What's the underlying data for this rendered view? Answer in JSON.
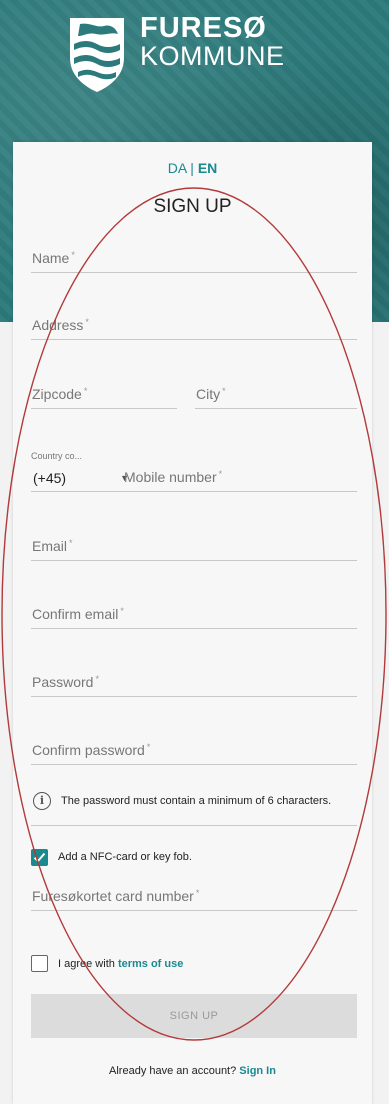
{
  "brand": {
    "line1": "FURESØ",
    "line2": "KOMMUNE"
  },
  "lang": {
    "da": "DA",
    "sep": "|",
    "en": "EN"
  },
  "title": "SIGN UP",
  "fields": {
    "name": "Name",
    "address": "Address",
    "zipcode": "Zipcode",
    "city": "City",
    "country_label": "Country co...",
    "country_value": "(+45)",
    "mobile": "Mobile number",
    "email": "Email",
    "confirm_email": "Confirm email",
    "password": "Password",
    "confirm_password": "Confirm password",
    "card_number": "Furesøkortet card number",
    "required_mark": "*"
  },
  "info": {
    "icon": "i",
    "text": "The password must contain a minimum of 6 characters."
  },
  "nfc": {
    "label": "Add a NFC-card or key fob.",
    "checked": true
  },
  "terms": {
    "prefix": "I agree with",
    "link": "terms of use",
    "checked": false
  },
  "submit_label": "SIGN UP",
  "account": {
    "text": "Already have an account?",
    "link": "Sign In"
  },
  "colors": {
    "accent": "#1a8a8f",
    "hero": "#2c7a7b",
    "annotation": "#b23a3a"
  }
}
